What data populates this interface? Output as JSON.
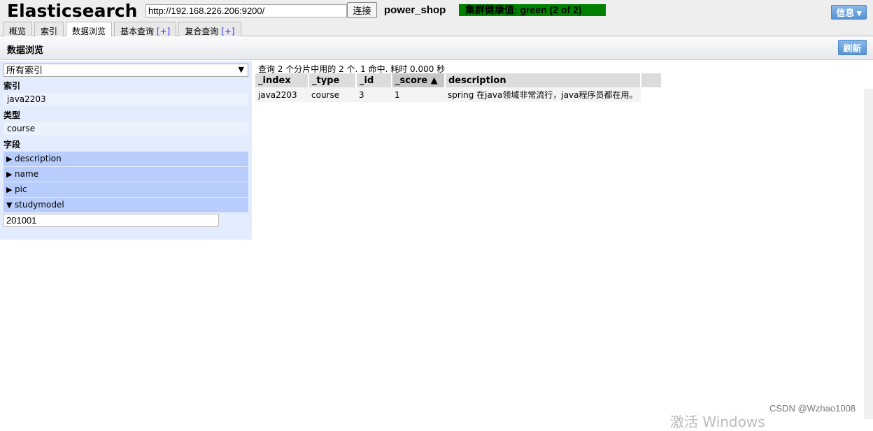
{
  "header": {
    "logo": "Elasticsearch",
    "url": "http://192.168.226.206:9200/",
    "connect_label": "连接",
    "cluster_name": "power_shop",
    "health": "集群健康值: green (2 of 2)",
    "health_color": "#008000",
    "info_label": "信息 ▾"
  },
  "tabs": [
    {
      "label": "概览"
    },
    {
      "label": "索引"
    },
    {
      "label": "数据浏览",
      "active": true
    },
    {
      "label": "基本查询",
      "plus": "[+]"
    },
    {
      "label": "复合查询",
      "plus": "[+]"
    }
  ],
  "subheader": {
    "title": "数据浏览",
    "refresh_label": "刷新"
  },
  "sidebar": {
    "index_select": "所有索引",
    "index_heading": "索引",
    "index_value": "java2203",
    "type_heading": "类型",
    "type_value": "course",
    "fields_heading": "字段",
    "fields": [
      {
        "name": "description",
        "expanded": false
      },
      {
        "name": "name",
        "expanded": false
      },
      {
        "name": "pic",
        "expanded": false
      },
      {
        "name": "studymodel",
        "expanded": true
      }
    ],
    "studymodel_filter": "201001"
  },
  "results": {
    "summary": "查询 2 个分片中用的 2 个. 1 命中. 耗时 0.000 秒",
    "columns": [
      "_index",
      "_type",
      "_id",
      "_score ▲",
      "description"
    ],
    "rows": [
      [
        "java2203",
        "course",
        "3",
        "1",
        "spring 在java领域非常流行，java程序员都在用。"
      ]
    ]
  },
  "watermark": "CSDN @Wzhao1008",
  "os_watermark": "激活 Windows"
}
